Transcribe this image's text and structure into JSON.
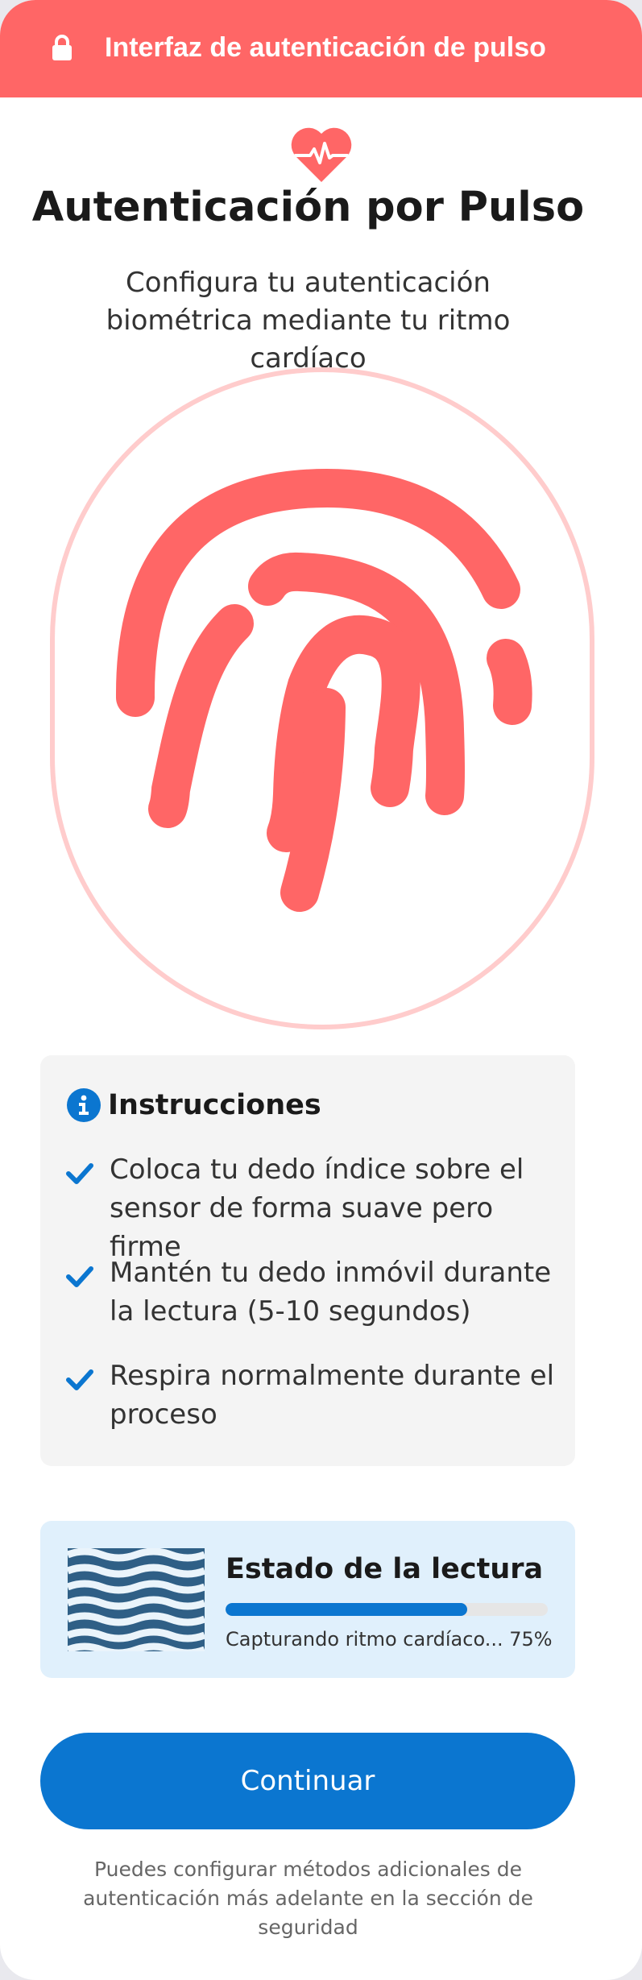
{
  "header": {
    "title": "Interfaz de autenticación de pulso",
    "icon": "lock-icon",
    "background": "#ff6666"
  },
  "main": {
    "heart_icon": "heart-pulse-icon",
    "title": "Autenticación por Pulso",
    "subtitle": "Configura tu autenticación biométrica mediante tu ritmo cardíaco",
    "scanner_icon": "fingerprint-icon",
    "accent_color": "#ff6666"
  },
  "instructions": {
    "icon": "info-icon",
    "title": "Instrucciones",
    "items": [
      {
        "icon": "check-icon",
        "text": "Coloca tu dedo índice sobre el sensor de forma suave pero firme"
      },
      {
        "icon": "check-icon",
        "text": "Mantén tu dedo inmóvil durante la lectura (5-10 segundos)"
      },
      {
        "icon": "check-icon",
        "text": "Respira normalmente durante el proceso"
      }
    ]
  },
  "status": {
    "title": "Estado de la lectura",
    "progress_percent": 75,
    "caption": "Capturando ritmo cardíaco... 75%",
    "progress_color": "#0b76d0"
  },
  "actions": {
    "continue_label": "Continuar",
    "button_color": "#0b76d0"
  },
  "footer": {
    "note": "Puedes configurar métodos adicionales de autenticación más adelante en la sección de seguridad"
  }
}
